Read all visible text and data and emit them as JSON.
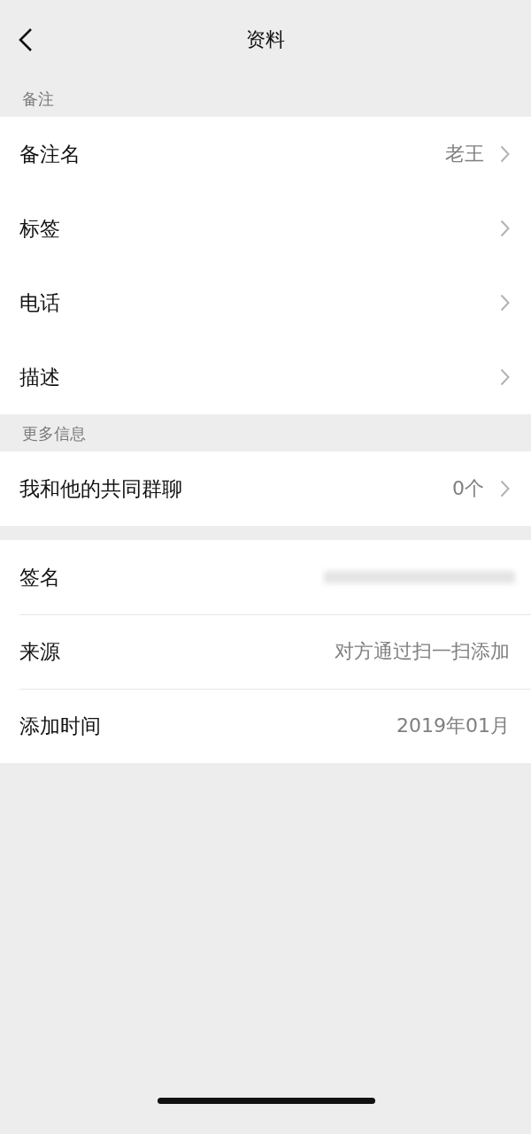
{
  "header": {
    "title": "资料"
  },
  "groups": [
    {
      "heading": "备注",
      "dividers": false,
      "rows": [
        {
          "kind": "text",
          "label": "备注名",
          "value": "老王",
          "chevron": true
        },
        {
          "kind": "text",
          "label": "标签",
          "chevron": true
        },
        {
          "kind": "text",
          "label": "电话",
          "chevron": true
        },
        {
          "kind": "text",
          "label": "描述",
          "chevron": true
        }
      ]
    },
    {
      "heading": "更多信息",
      "dividers": false,
      "rows": [
        {
          "kind": "text",
          "label": "我和他的共同群聊",
          "value": "0个",
          "chevron": true
        }
      ]
    },
    {
      "dividers": true,
      "rows": [
        {
          "kind": "redacted",
          "label": "签名",
          "chevron": false
        },
        {
          "kind": "text",
          "label": "来源",
          "value": "对方通过扫一扫添加",
          "chevron": false
        },
        {
          "kind": "text",
          "label": "添加时间",
          "value": "2019年01月",
          "chevron": false
        }
      ]
    }
  ]
}
